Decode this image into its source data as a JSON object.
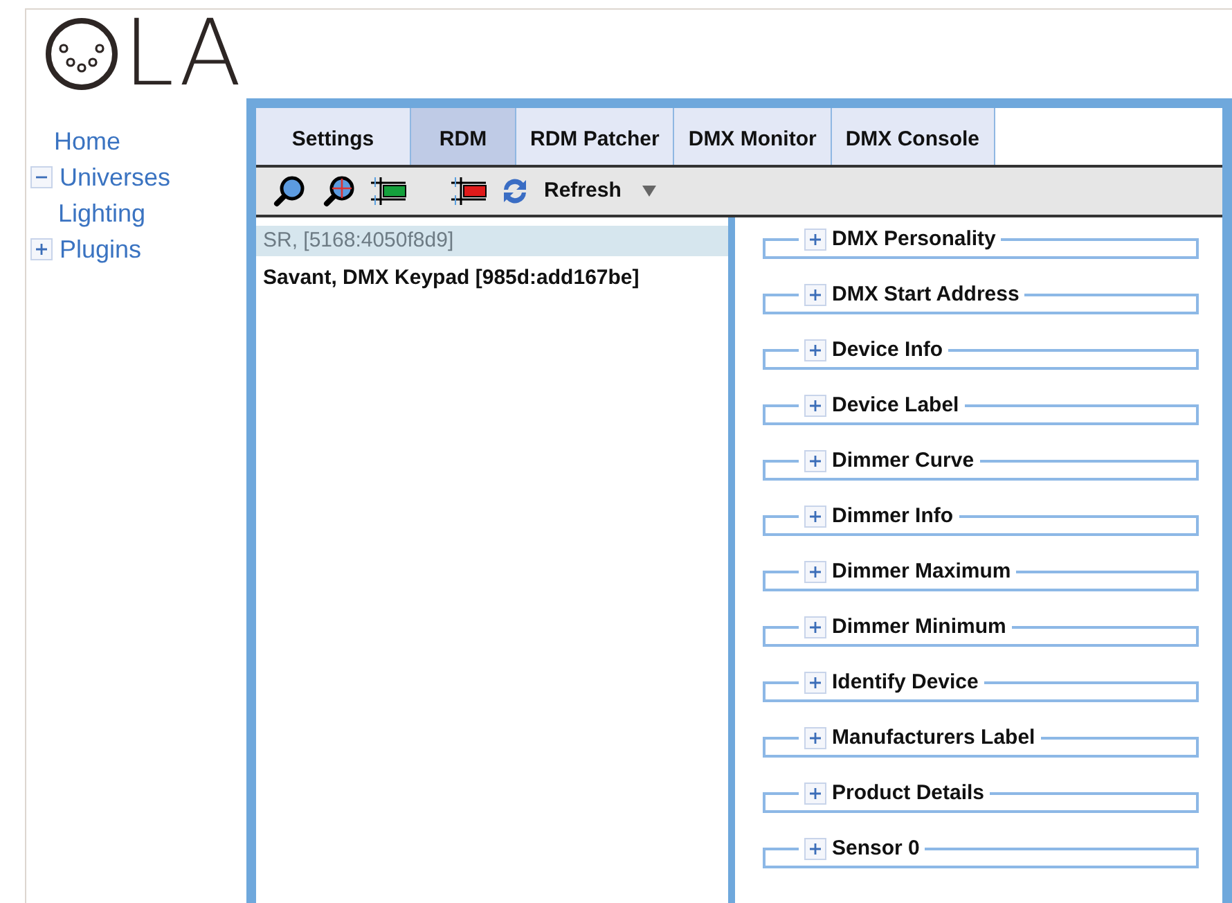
{
  "logo": {
    "text": "LA"
  },
  "nav": [
    {
      "label": "Home"
    },
    {
      "label": "Universes",
      "expanded": true,
      "children": [
        {
          "label": "Lighting"
        }
      ]
    },
    {
      "label": "Plugins",
      "expanded": false
    }
  ],
  "tabs": [
    {
      "label": "Settings",
      "selected": false
    },
    {
      "label": "RDM",
      "selected": true
    },
    {
      "label": "RDM Patcher",
      "selected": false
    },
    {
      "label": "DMX Monitor",
      "selected": false
    },
    {
      "label": "DMX Console",
      "selected": false
    }
  ],
  "toolbar": {
    "refresh": "Refresh"
  },
  "devices": [
    {
      "label": "SR, [5168:4050f8d9]",
      "selected": true
    },
    {
      "label": "Savant, DMX Keypad [985d:add167be]",
      "selected": false
    }
  ],
  "sections": [
    {
      "label": "DMX Personality",
      "expanded": false
    },
    {
      "label": "DMX Start Address",
      "expanded": false
    },
    {
      "label": "Device Info",
      "expanded": false
    },
    {
      "label": "Device Label",
      "expanded": false
    },
    {
      "label": "Dimmer Curve",
      "expanded": false
    },
    {
      "label": "Dimmer Info",
      "expanded": false
    },
    {
      "label": "Dimmer Maximum",
      "expanded": false
    },
    {
      "label": "Dimmer Minimum",
      "expanded": false
    },
    {
      "label": "Identify Device",
      "expanded": false
    },
    {
      "label": "Manufacturers Label",
      "expanded": false
    },
    {
      "label": "Product Details",
      "expanded": false
    },
    {
      "label": "Sensor 0",
      "expanded": false
    }
  ]
}
